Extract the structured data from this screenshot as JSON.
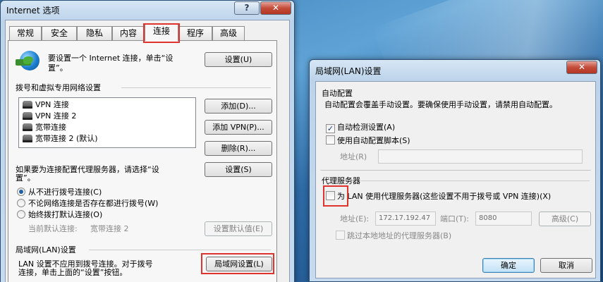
{
  "internet_options": {
    "title": "Internet 选项",
    "help_btn": "?",
    "close_btn": "✕",
    "tabs": [
      "常规",
      "安全",
      "隐私",
      "内容",
      "连接",
      "程序",
      "高级"
    ],
    "setup_text_1": "要设置一个 Internet 连接，单击“设",
    "setup_text_2": "置”。",
    "setup_btn": "设置(U)",
    "dialup_section": "拨号和虚拟专用网络设置",
    "connections": [
      "VPN 连接",
      "VPN 连接 2",
      "宽带连接",
      "宽带连接 2 (默认)"
    ],
    "add_btn": "添加(D)...",
    "add_vpn_btn": "添加 VPN(P)...",
    "remove_btn": "删除(R)...",
    "proxy_text_1": "如果要为连接配置代理服务器，请选择“设",
    "proxy_text_2": "置”。",
    "settings_btn": "设置(S)",
    "radio_never": "从不进行拨号连接(C)",
    "radio_no_network": "不论网络连接是否存在都进行拨号(W)",
    "radio_always": "始终拨打默认连接(O)",
    "current_default_label": "当前默认连接:",
    "current_default_value": "宽带连接 2",
    "set_default_btn": "设置默认值(E)",
    "lan_section": "局域网(LAN)设置",
    "lan_text_1": "LAN 设置不应用到拨号连接。对于拨号",
    "lan_text_2": "连接，单击上面的“设置”按钮。",
    "lan_btn": "局域网设置(L)"
  },
  "lan_dialog": {
    "title": "局域网(LAN)设置",
    "close_btn": "✕",
    "auto_config_header": "自动配置",
    "auto_config_desc": "自动配置会覆盖手动设置。要确保使用手动设置，请禁用自动配置。",
    "auto_detect_label": "自动检测设置(A)",
    "auto_detect_checked": true,
    "use_script_label": "使用自动配置脚本(S)",
    "address_label": "地址(R)",
    "proxy_header": "代理服务器",
    "use_proxy_prefix": "为",
    "use_proxy_label": "LAN 使用代理服务器(这些设置不用于拨号或 VPN 连接)(X)",
    "proxy_address_label": "地址(E):",
    "proxy_address_value": "172.17.192.47",
    "port_label": "端口(T):",
    "port_value": "8080",
    "advanced_btn": "高级(C)",
    "bypass_label": "跳过本地地址的代理服务器(B)",
    "ok_btn": "确定",
    "cancel_btn": "取消"
  }
}
